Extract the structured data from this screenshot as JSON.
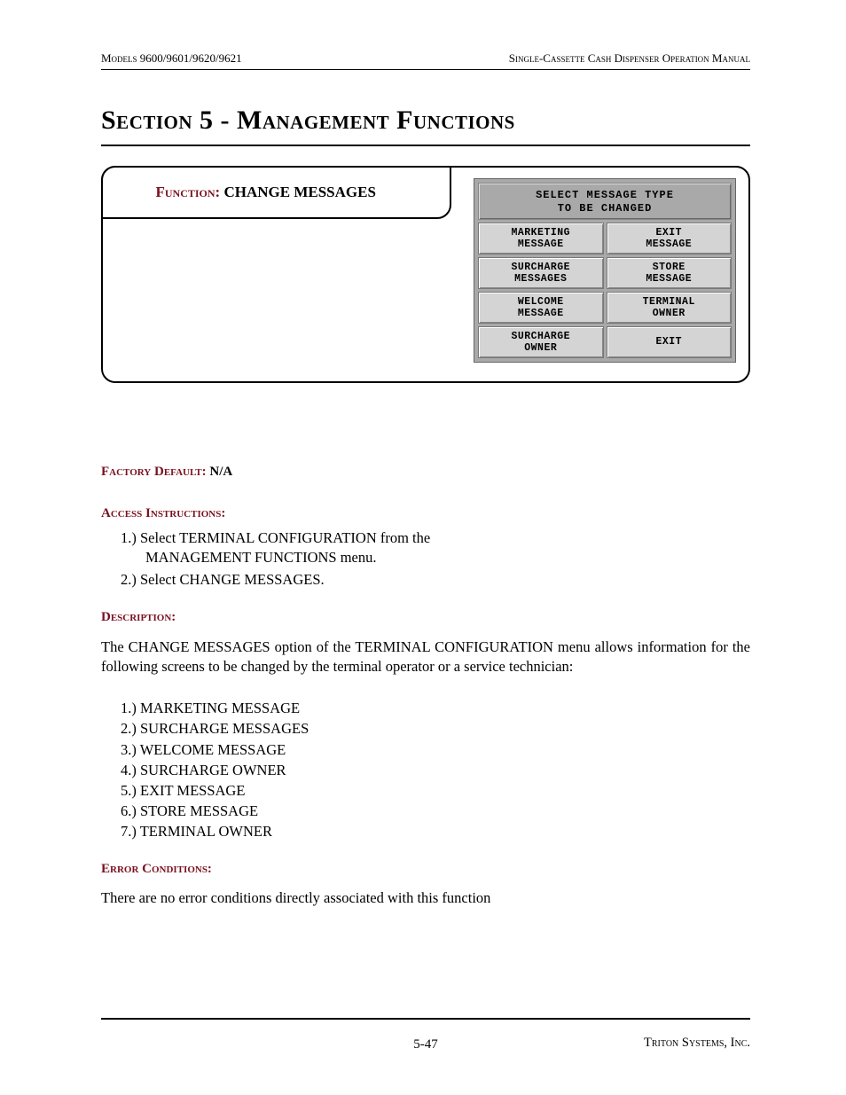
{
  "header": {
    "left": "Models 9600/9601/9620/9621",
    "right": "Single-Cassette Cash Dispenser Operation Manual"
  },
  "section_title": "Section 5 - Management Functions",
  "function_box": {
    "label": "Function:",
    "name": "CHANGE MESSAGES"
  },
  "screen": {
    "title": "SELECT MESSAGE TYPE\nTO BE CHANGED",
    "buttons": [
      "MARKETING\nMESSAGE",
      "EXIT\nMESSAGE",
      "SURCHARGE\nMESSAGES",
      "STORE\nMESSAGE",
      "WELCOME\nMESSAGE",
      "TERMINAL\nOWNER",
      "SURCHARGE\nOWNER",
      "EXIT"
    ]
  },
  "factory_default": {
    "label": "Factory Default:",
    "value": "N/A"
  },
  "access": {
    "label": "Access Instructions:",
    "steps": [
      "Select TERMINAL CONFIGURATION from the MANAGEMENT FUNCTIONS menu.",
      "Select CHANGE MESSAGES."
    ]
  },
  "description": {
    "label": "Description:",
    "text": "The CHANGE MESSAGES option of the TERMINAL CONFIGURATION menu allows information for the following screens to be changed by the terminal operator or a service technician:"
  },
  "message_list": [
    "MARKETING MESSAGE",
    "SURCHARGE MESSAGES",
    "WELCOME MESSAGE",
    "SURCHARGE OWNER",
    "EXIT MESSAGE",
    "STORE MESSAGE",
    "TERMINAL OWNER"
  ],
  "error": {
    "label": "Error Conditions:",
    "text": "There are no error conditions directly associated with this function"
  },
  "footer": {
    "page_number": "5-47",
    "company": "Triton Systems, Inc."
  }
}
